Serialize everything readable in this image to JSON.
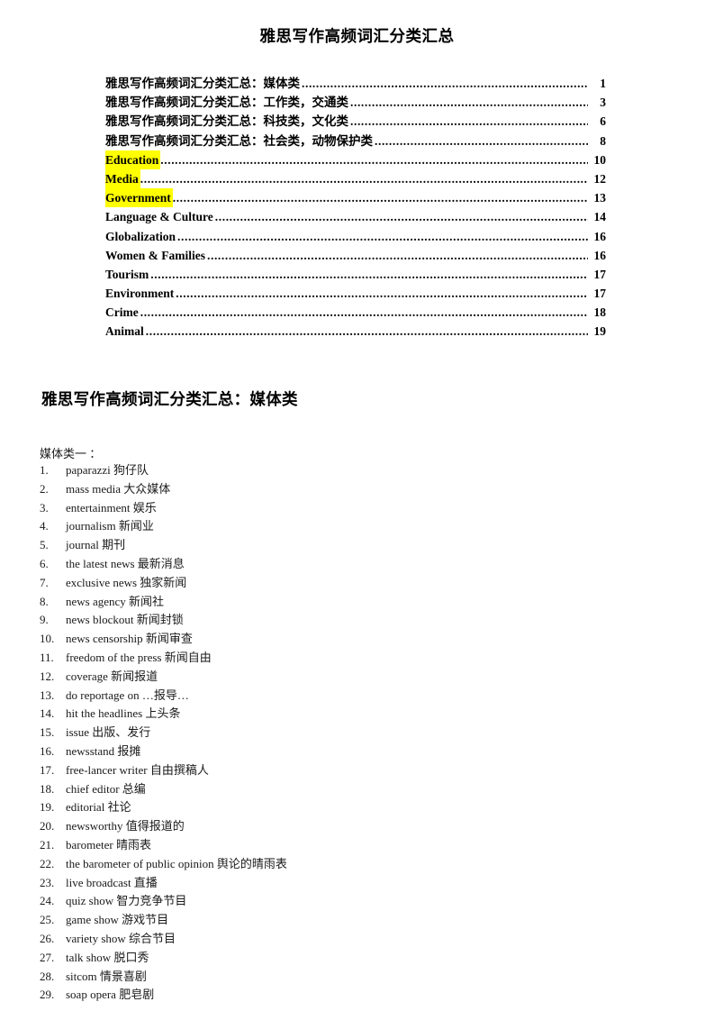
{
  "document": {
    "title": "雅思写作高频词汇分类汇总",
    "highlight_color": "#ffff00",
    "text_color": "#000000"
  },
  "toc": {
    "entries": [
      {
        "label": "雅思写作高频词汇分类汇总：媒体类",
        "page": "1",
        "highlight": false,
        "cjk": true
      },
      {
        "label": "雅思写作高频词汇分类汇总：工作类，交通类",
        "page": "3",
        "highlight": false,
        "cjk": true
      },
      {
        "label": "雅思写作高频词汇分类汇总：科技类，文化类",
        "page": "6",
        "highlight": false,
        "cjk": true
      },
      {
        "label": "雅思写作高频词汇分类汇总：社会类，动物保护类",
        "page": "8",
        "highlight": false,
        "cjk": true
      },
      {
        "label": "Education",
        "page": "10",
        "highlight": true,
        "cjk": false
      },
      {
        "label": "Media",
        "page": "12",
        "highlight": true,
        "cjk": false
      },
      {
        "label": "Government",
        "page": "13",
        "highlight": true,
        "cjk": false
      },
      {
        "label": "Language & Culture",
        "page": "14",
        "highlight": false,
        "cjk": false
      },
      {
        "label": "Globalization",
        "page": "16",
        "highlight": false,
        "cjk": false
      },
      {
        "label": "Women & Families",
        "page": "16",
        "highlight": false,
        "cjk": false
      },
      {
        "label": "Tourism",
        "page": "17",
        "highlight": false,
        "cjk": false
      },
      {
        "label": "Environment",
        "page": "17",
        "highlight": false,
        "cjk": false
      },
      {
        "label": "Crime",
        "page": "18",
        "highlight": false,
        "cjk": false
      },
      {
        "label": "Animal",
        "page": "19",
        "highlight": false,
        "cjk": false
      }
    ]
  },
  "section": {
    "heading": "雅思写作高频词汇分类汇总：媒体类",
    "sub_label": "媒体类一 ："
  },
  "vocab": {
    "items": [
      {
        "num": "1.",
        "text": "paparazzi 狗仔队"
      },
      {
        "num": "2.",
        "text": "mass media 大众媒体"
      },
      {
        "num": "3.",
        "text": "entertainment 娱乐"
      },
      {
        "num": "4.",
        "text": "journalism 新闻业"
      },
      {
        "num": "5.",
        "text": "journal 期刊"
      },
      {
        "num": "6.",
        "text": "the latest news 最新消息"
      },
      {
        "num": "7.",
        "text": "exclusive news 独家新闻"
      },
      {
        "num": "8.",
        "text": "news agency 新闻社"
      },
      {
        "num": "9.",
        "text": "news   blockout  新闻封锁"
      },
      {
        "num": "10.",
        "text": "news censorship 新闻审查"
      },
      {
        "num": "11.",
        "text": "freedom of the press 新闻自由"
      },
      {
        "num": "12.",
        "text": "coverage 新闻报道"
      },
      {
        "num": "13.",
        "text": "do reportage on …报导…"
      },
      {
        "num": "14.",
        "text": "hit the headlines 上头条"
      },
      {
        "num": "15.",
        "text": "issue 出版、发行"
      },
      {
        "num": "16.",
        "text": "newsstand 报摊"
      },
      {
        "num": "17.",
        "text": "free-lancer writer 自由撰稿人"
      },
      {
        "num": "18.",
        "text": "chief editor 总编"
      },
      {
        "num": "19.",
        "text": "editorial 社论"
      },
      {
        "num": "20.",
        "text": "newsworthy 值得报道的"
      },
      {
        "num": "21.",
        "text": "barometer 晴雨表"
      },
      {
        "num": "22.",
        "text": "the barometer of public opinion 舆论的晴雨表"
      },
      {
        "num": "23.",
        "text": "live broadcast 直播"
      },
      {
        "num": "24.",
        "text": "quiz show 智力竞争节目"
      },
      {
        "num": "25.",
        "text": "game show 游戏节目"
      },
      {
        "num": "26.",
        "text": "variety show 综合节目"
      },
      {
        "num": "27.",
        "text": "talk show 脱口秀"
      },
      {
        "num": "28.",
        "text": "sitcom 情景喜剧"
      },
      {
        "num": "29.",
        "text": "soap opera 肥皂剧"
      }
    ]
  }
}
